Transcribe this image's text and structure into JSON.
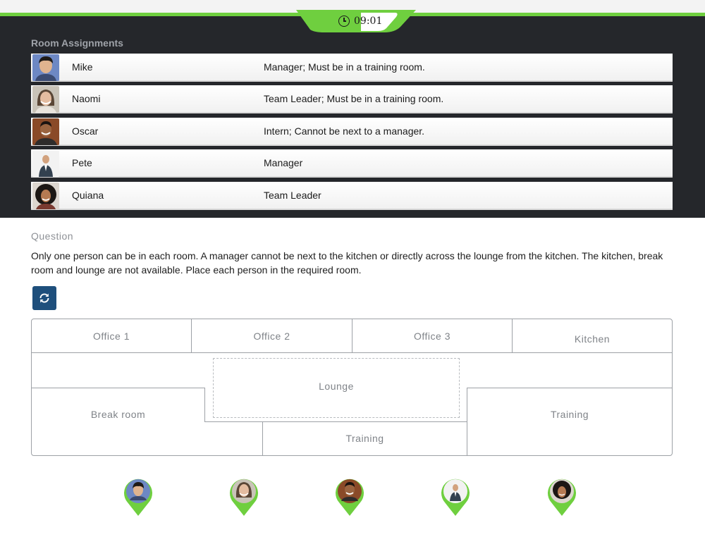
{
  "timer": {
    "label": "09:01"
  },
  "room_assignments": {
    "title": "Room Assignments",
    "people": [
      {
        "name": "Mike",
        "description": "Manager; Must be in a training room."
      },
      {
        "name": "Naomi",
        "description": "Team Leader; Must be in a training room."
      },
      {
        "name": "Oscar",
        "description": "Intern; Cannot be next to a manager."
      },
      {
        "name": "Pete",
        "description": "Manager"
      },
      {
        "name": "Quiana",
        "description": "Team Leader"
      }
    ]
  },
  "question": {
    "title": "Question",
    "text": "Only one person can be in each room. A manager cannot be next to the kitchen or directly across the lounge from the kitchen. The kitchen, break room and lounge are not available. Place each person in the required room."
  },
  "floorplan": {
    "office1": "Office 1",
    "office2": "Office 2",
    "office3": "Office 3",
    "kitchen": "Kitchen",
    "lounge": "Lounge",
    "break_room": "Break room",
    "training_bottom": "Training",
    "training_right": "Training"
  },
  "colors": {
    "accent_green": "#6fcf3f",
    "dark_bg": "#25272b",
    "button_blue": "#1e4f7c"
  }
}
